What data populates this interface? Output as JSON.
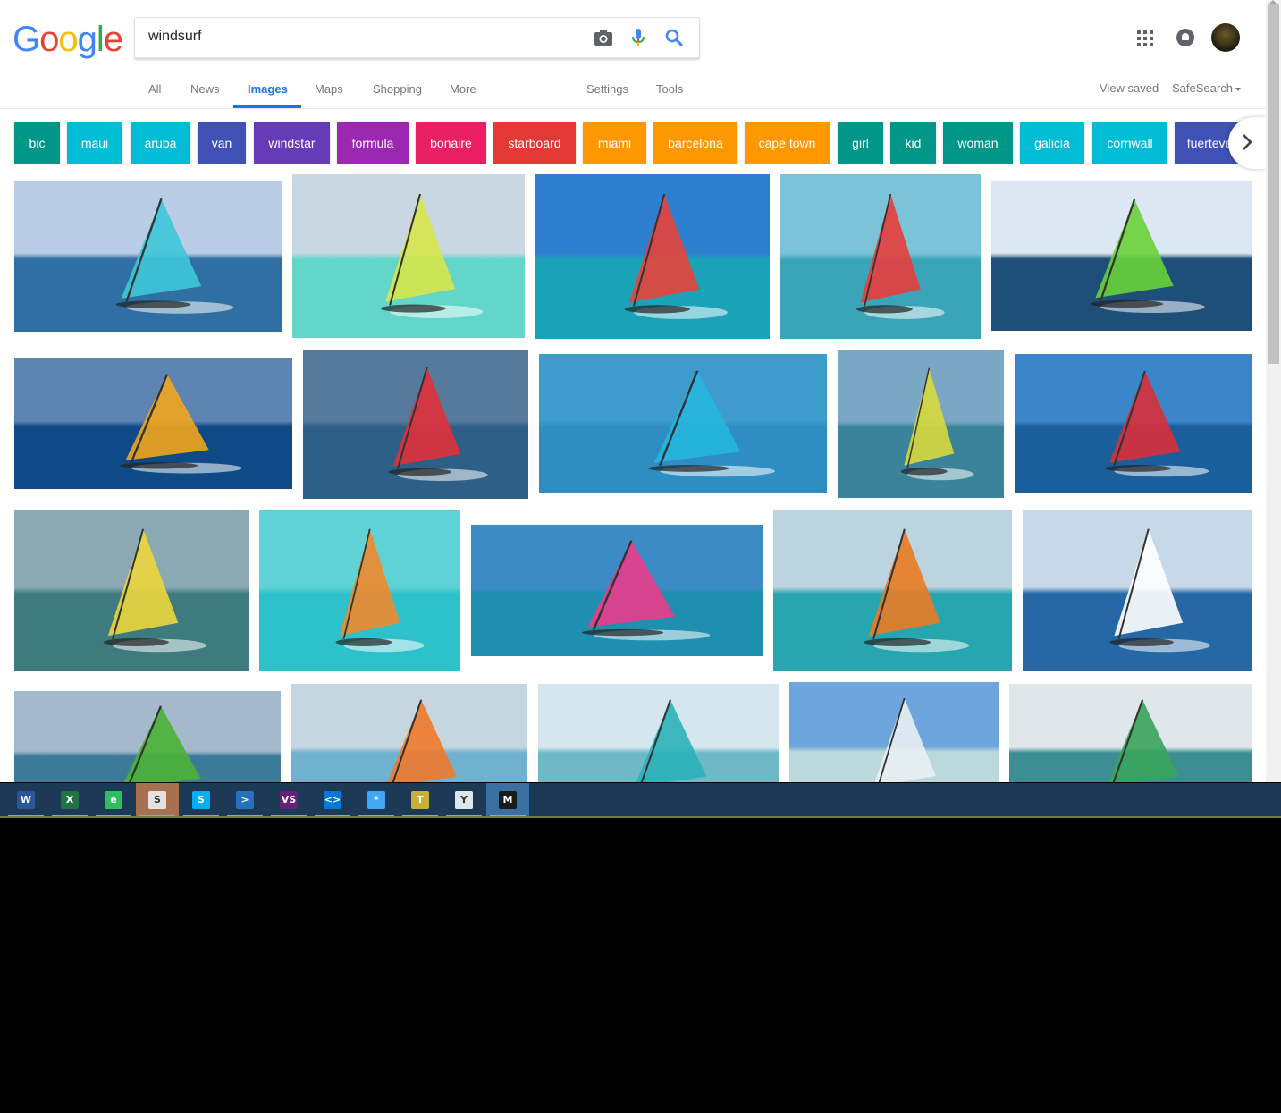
{
  "logo": {
    "letters": [
      "G",
      "o",
      "o",
      "g",
      "l",
      "e"
    ],
    "colors": [
      "#4285f4",
      "#ea4335",
      "#fbbc05",
      "#4285f4",
      "#34a853",
      "#ea4335"
    ]
  },
  "search": {
    "query": "windsurf",
    "icons": [
      "camera-icon",
      "microphone-icon",
      "search-icon"
    ]
  },
  "header_icons": [
    "apps-grid-icon",
    "notifications-icon",
    "avatar"
  ],
  "tabs": [
    {
      "label": "All",
      "active": false
    },
    {
      "label": "News",
      "active": false
    },
    {
      "label": "Images",
      "active": true
    },
    {
      "label": "Maps",
      "active": false
    },
    {
      "label": "Shopping",
      "active": false
    },
    {
      "label": "More",
      "active": false
    },
    {
      "label": "Settings",
      "active": false
    },
    {
      "label": "Tools",
      "active": false
    }
  ],
  "right_links": {
    "view_saved": "View saved",
    "safesearch": "SafeSearch"
  },
  "chips": [
    {
      "label": "bic",
      "color": "#009688"
    },
    {
      "label": "maui",
      "color": "#00bcd4"
    },
    {
      "label": "aruba",
      "color": "#00bcd4"
    },
    {
      "label": "van",
      "color": "#3f51b5"
    },
    {
      "label": "windstar",
      "color": "#673ab7"
    },
    {
      "label": "formula",
      "color": "#9c27b0"
    },
    {
      "label": "bonaire",
      "color": "#e91e63"
    },
    {
      "label": "starboard",
      "color": "#e53935"
    },
    {
      "label": "miami",
      "color": "#ff9800"
    },
    {
      "label": "barcelona",
      "color": "#ff9800"
    },
    {
      "label": "cape town",
      "color": "#ff9800"
    },
    {
      "label": "girl",
      "color": "#009688"
    },
    {
      "label": "kid",
      "color": "#009688"
    },
    {
      "label": "woman",
      "color": "#009688"
    },
    {
      "label": "galicia",
      "color": "#00bcd4"
    },
    {
      "label": "cornwall",
      "color": "#00bcd4"
    },
    {
      "label": "fuerteventura",
      "color": "#3f51b5"
    }
  ],
  "chip_next_icon": "chevron-right-icon",
  "results": [
    {
      "sky": "#b9cde6",
      "sea": "#2f6fa3",
      "sail": "#3ec7d8"
    },
    {
      "sky": "#c9d7e3",
      "sea": "#62d6c8",
      "sail": "#d7e64b"
    },
    {
      "sky": "#2f7fd0",
      "sea": "#1aa3b8",
      "sail": "#e8433a"
    },
    {
      "sky": "#7bc3d6",
      "sea": "#3aa5b8",
      "sail": "#e83d3d"
    },
    {
      "sky": "#dbe7f2",
      "sea": "#1e4f7a",
      "sail": "#69d23a"
    },
    {
      "sky": "#5d84b3",
      "sea": "#0f4a86",
      "sail": "#f2a51c"
    },
    {
      "sky": "#557a9c",
      "sea": "#2d5f87",
      "sail": "#e0303a"
    },
    {
      "sky": "#3d9ccc",
      "sea": "#2e8ec4",
      "sail": "#26b7de"
    },
    {
      "sky": "#7aa8c4",
      "sea": "#3a8398",
      "sail": "#d8d93c"
    },
    {
      "sky": "#3b86c9",
      "sea": "#1a5f9c",
      "sail": "#d9303a"
    },
    {
      "sky": "#8aa9b3",
      "sea": "#3e7b7f",
      "sail": "#ecd63c"
    },
    {
      "sky": "#5fd2d6",
      "sea": "#2ec1cb",
      "sail": "#f08a2c"
    },
    {
      "sky": "#3c8bc6",
      "sea": "#1f8fb0",
      "sail": "#ea3c8c"
    },
    {
      "sky": "#bcd3e0",
      "sea": "#27a6b0",
      "sail": "#ea7b24"
    },
    {
      "sky": "#c7d8e8",
      "sea": "#2667a6",
      "sail": "#ffffff"
    },
    {
      "sky": "#a4b9cc",
      "sea": "#3c7a9a",
      "sail": "#4bb336"
    },
    {
      "sky": "#c5d6e0",
      "sea": "#6fb1cf",
      "sail": "#f07a2a"
    },
    {
      "sky": "#d6e6ee",
      "sea": "#6fb9c7",
      "sail": "#2bb1b8"
    },
    {
      "sky": "#6da6dc",
      "sea": "#b9d9dc",
      "sail": "#e9eef2"
    },
    {
      "sky": "#dfe7ea",
      "sea": "#3d8e92",
      "sail": "#38a35c"
    }
  ],
  "taskbar": [
    {
      "name": "word-icon",
      "color": "#2b579a",
      "glyph": "W"
    },
    {
      "name": "excel-icon",
      "color": "#217346",
      "glyph": "X"
    },
    {
      "name": "evernote-icon",
      "color": "#2dbe60",
      "glyph": "e"
    },
    {
      "name": "slack-notification-icon",
      "color": "#e2e2e2",
      "glyph": "S"
    },
    {
      "name": "skype-icon",
      "color": "#00aff0",
      "glyph": "S"
    },
    {
      "name": "powershell-icon",
      "color": "#2671be",
      "glyph": ">"
    },
    {
      "name": "visual-studio-icon",
      "color": "#68217a",
      "glyph": "VS"
    },
    {
      "name": "vscode-icon",
      "color": "#0078d7",
      "glyph": "<>"
    },
    {
      "name": "pinwheel-icon",
      "color": "#3fa9f5",
      "glyph": "*"
    },
    {
      "name": "tools-icon",
      "color": "#c7b03a",
      "glyph": "T"
    },
    {
      "name": "tree-app-icon",
      "color": "#dfe6ea",
      "glyph": "Y"
    },
    {
      "name": "merge-app-icon",
      "color": "#1a1a1a",
      "glyph": "M"
    }
  ]
}
